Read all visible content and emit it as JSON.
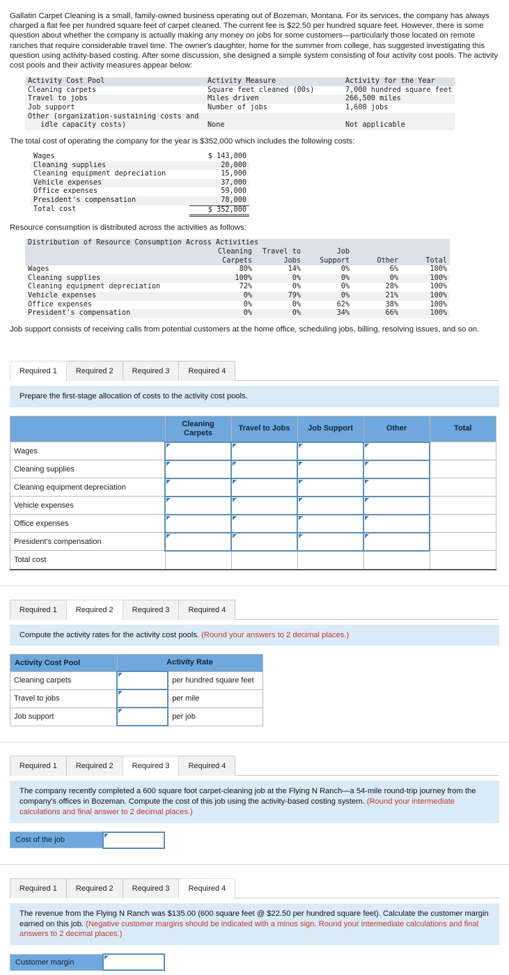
{
  "intro": {
    "paragraph": "Gallatin Carpet Cleaning is a small, family-owned business operating out of Bozeman, Montana. For its services, the company has always charged a flat fee per hundred square feet of carpet cleaned. The current fee is $22.50 per hundred square feet. However, there is some question about whether the company is actually making any money on jobs for some customers—particularly those located on remote ranches that require considerable travel time. The owner's daughter, home for the summer from college, has suggested investigating this question using activity-based costing. After some discussion, she designed a simple system consisting of four activity cost pools. The activity cost pools and their activity measures appear below:",
    "total_cost_sentence": "The total cost of operating the company for the year is $352,000 which includes the following costs:",
    "resource_sentence": "Resource consumption is distributed across the activities as follows:",
    "job_support_sentence": "Job support consists of receiving calls from potential customers at the home office, scheduling jobs, billing, resolving issues, and so on."
  },
  "exhibit_activity_pools": {
    "headers": [
      "Activity Cost Pool",
      "Activity Measure",
      "Activity for the Year"
    ],
    "rows": [
      [
        "Cleaning carpets",
        "Square feet cleaned (00s)",
        "7,000 hundred square feet"
      ],
      [
        "Travel to jobs",
        "Miles driven",
        "266,500 miles"
      ],
      [
        "Job support",
        "Number of jobs",
        "1,600 jobs"
      ],
      [
        "Other (organization-sustaining costs and",
        "",
        ""
      ],
      [
        "   idle capacity costs)",
        "None",
        "Not applicable"
      ]
    ]
  },
  "exhibit_costs": {
    "rows": [
      [
        "Wages",
        "$ 143,000"
      ],
      [
        "Cleaning supplies",
        "20,000"
      ],
      [
        "Cleaning equipment depreciation",
        "15,000"
      ],
      [
        "Vehicle expenses",
        "37,000"
      ],
      [
        "Office expenses",
        "59,000"
      ],
      [
        "President's compensation",
        "78,000"
      ]
    ],
    "total_label": "Total cost",
    "total_value": "$ 352,000"
  },
  "exhibit_distribution": {
    "title": "Distribution of Resource Consumption Across Activities",
    "col_headers_line1": [
      "Cleaning",
      "Travel to",
      "Job",
      "",
      ""
    ],
    "col_headers_line2": [
      "Carpets",
      "Jobs",
      "Support",
      "Other",
      "Total"
    ],
    "rows": [
      {
        "label": "Wages",
        "values": [
          "80%",
          "14%",
          "0%",
          "6%",
          "100%"
        ]
      },
      {
        "label": "Cleaning supplies",
        "values": [
          "100%",
          "0%",
          "0%",
          "0%",
          "100%"
        ]
      },
      {
        "label": "Cleaning equipment depreciation",
        "values": [
          "72%",
          "0%",
          "0%",
          "28%",
          "100%"
        ]
      },
      {
        "label": "Vehicle expenses",
        "values": [
          "0%",
          "79%",
          "0%",
          "21%",
          "100%"
        ]
      },
      {
        "label": "Office expenses",
        "values": [
          "0%",
          "0%",
          "62%",
          "38%",
          "100%"
        ]
      },
      {
        "label": "President's compensation",
        "values": [
          "0%",
          "0%",
          "34%",
          "66%",
          "100%"
        ]
      }
    ]
  },
  "tabs": [
    "Required 1",
    "Required 2",
    "Required 3",
    "Required 4"
  ],
  "required1": {
    "active_tab_index": 0,
    "instruction": "Prepare the first-stage allocation of costs to the activity cost pools.",
    "hint": "",
    "table": {
      "headers": [
        "",
        "Cleaning Carpets",
        "Travel to Jobs",
        "Job Support",
        "Other",
        "Total"
      ],
      "header_cleaning_carpets_line1": "Cleaning",
      "header_cleaning_carpets_line2": "Carpets",
      "rows": [
        "Wages",
        "Cleaning supplies",
        "Cleaning equipment depreciation",
        "Vehicle expenses",
        "Office expenses",
        "President's compensation"
      ],
      "total_row_label": "Total cost"
    }
  },
  "required2": {
    "active_tab_index": 1,
    "instruction_main": "Compute the activity rates for the activity cost pools.",
    "instruction_hint": "(Round your answers to 2 decimal places.)",
    "table": {
      "headers": [
        "Activity Cost Pool",
        "Activity Rate"
      ],
      "rows": [
        {
          "pool": "Cleaning carpets",
          "unit": "per hundred square feet"
        },
        {
          "pool": "Travel to jobs",
          "unit": "per mile"
        },
        {
          "pool": "Job support",
          "unit": "per job"
        }
      ]
    }
  },
  "required3": {
    "active_tab_index": 2,
    "instruction_main": "The company recently completed a 600 square foot carpet-cleaning job at the Flying N Ranch—a 54-mile round-trip journey from the company's offices in Bozeman. Compute the cost of this job using the activity-based costing system.",
    "instruction_hint": "(Round your intermediate calculations and final answer to 2 decimal places.)",
    "answer_label": "Cost of the job"
  },
  "required4": {
    "active_tab_index": 3,
    "instruction_main": "The revenue from the Flying N Ranch was $135.00 (600 square feet @ $22.50 per hundred square feet). Calculate the customer margin earned on this job.",
    "instruction_hint": "(Negative customer margins should be indicated with a minus sign. Round your intermediate calculations and final answers to 2 decimal places.)",
    "answer_label": "Customer margin"
  },
  "colors": {
    "header_blue": "#6fa8dc",
    "instruction_blue": "#dbeaf7",
    "hint_red": "#c0392b",
    "exhibit_header_gray": "#dde2ea"
  }
}
